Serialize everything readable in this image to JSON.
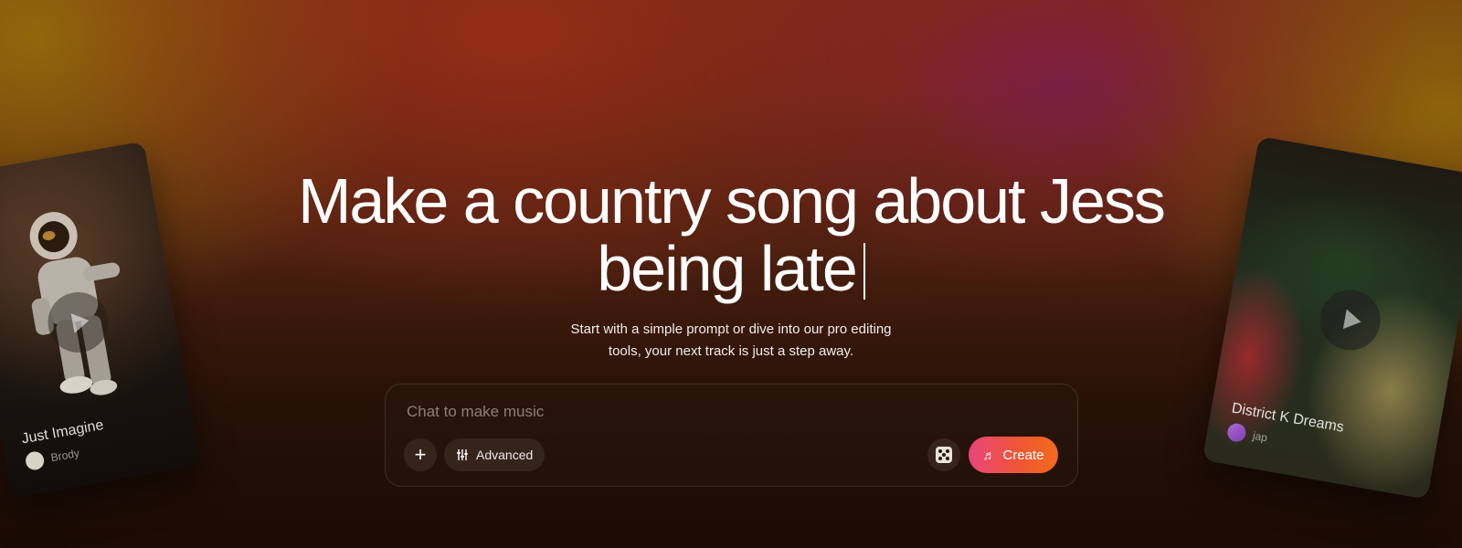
{
  "hero": {
    "headline": "Make a country song about Jess being late",
    "subtitle": "Start with a simple prompt or dive into our pro editing tools, your next track is just a step away."
  },
  "chat": {
    "placeholder": "Chat to make music",
    "advanced_label": "Advanced",
    "create_label": "Create"
  },
  "cards": [
    {
      "title": "Just Imagine",
      "author": "Brody"
    },
    {
      "title": "District K Dreams",
      "author": "jap"
    }
  ],
  "colors": {
    "create_gradient_start": "#e8457a",
    "create_gradient_end": "#f06a1e"
  }
}
